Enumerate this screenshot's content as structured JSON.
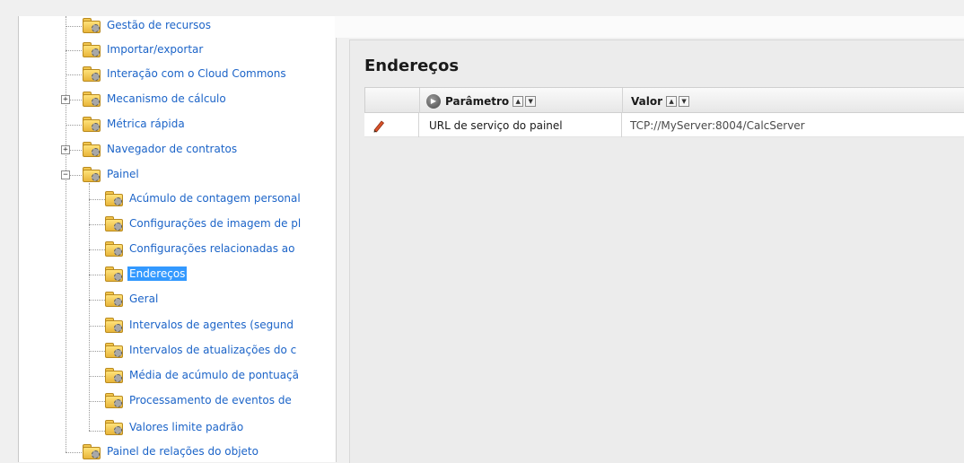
{
  "tree": {
    "items": [
      {
        "label": "Gestão de recursos",
        "expander": null
      },
      {
        "label": "Importar/exportar",
        "expander": null
      },
      {
        "label": "Interação com o Cloud Commons",
        "expander": null
      },
      {
        "label": "Mecanismo de cálculo",
        "expander": "+"
      },
      {
        "label": "Métrica rápida",
        "expander": null
      },
      {
        "label": "Navegador de contratos",
        "expander": "+"
      },
      {
        "label": "Painel",
        "expander": "−"
      },
      {
        "label": "Acúmulo de contagem personal",
        "expander": null
      },
      {
        "label": "Configurações de imagem de pl",
        "expander": null
      },
      {
        "label": "Configurações relacionadas ao",
        "expander": null
      },
      {
        "label": "Endereços",
        "expander": null,
        "selected": true
      },
      {
        "label": "Geral",
        "expander": null
      },
      {
        "label": "Intervalos de agentes (segund",
        "expander": null
      },
      {
        "label": "Intervalos de atualizações do c",
        "expander": null
      },
      {
        "label": "Média de acúmulo de pontuaçã",
        "expander": null
      },
      {
        "label": "Processamento de eventos de",
        "expander": null
      },
      {
        "label": "Valores limite padrão",
        "expander": null
      },
      {
        "label": "Painel de relações do objeto",
        "expander": null
      }
    ]
  },
  "content": {
    "title": "Endereços",
    "columns": {
      "param": "Parâmetro",
      "value": "Valor"
    },
    "sort_up": "▲",
    "sort_down": "▼",
    "rows": [
      {
        "param": "URL de serviço do painel",
        "value": "TCP://MyServer:8004/CalcServer"
      }
    ]
  },
  "icons": {
    "folder": "settings-folder-icon",
    "edit": "pencil-icon",
    "param_header": "sort-indicator-icon"
  },
  "colors": {
    "link": "#1c64c8",
    "selection": "#3399ff"
  }
}
